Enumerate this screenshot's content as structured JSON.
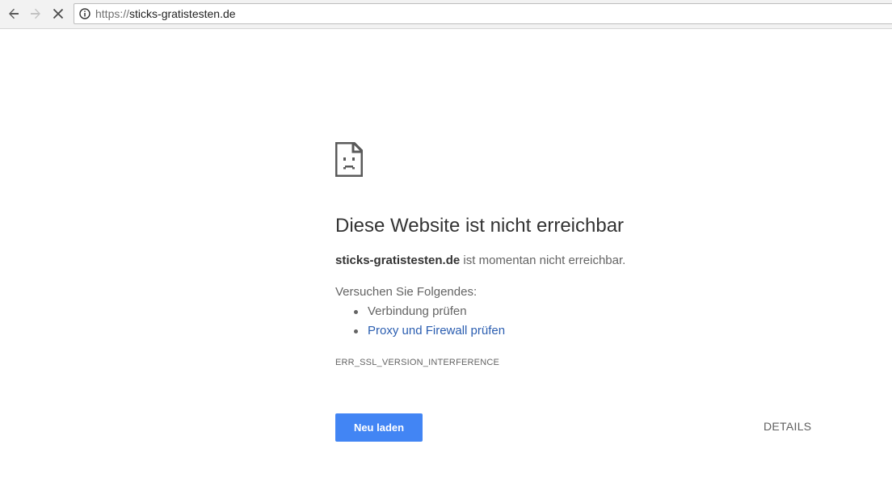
{
  "browser": {
    "back_icon": "arrow-left-icon",
    "forward_icon": "arrow-right-icon",
    "stop_icon": "close-icon",
    "info_icon": "info-icon",
    "url_scheme": "https://",
    "url_host": "sticks-gratistesten.de"
  },
  "error_page": {
    "icon": "sad-document-icon",
    "title": "Diese Website ist nicht erreichbar",
    "host": "sticks-gratistesten.de",
    "subtitle_suffix": " ist momentan nicht erreichbar.",
    "suggestions_heading": "Versuchen Sie Folgendes:",
    "suggestions": [
      {
        "label": "Verbindung prüfen",
        "is_link": false
      },
      {
        "label": "Proxy und Firewall prüfen",
        "is_link": true
      }
    ],
    "error_code": "ERR_SSL_VERSION_INTERFERENCE",
    "reload_label": "Neu laden",
    "details_label": "DETAILS"
  },
  "colors": {
    "primary_button": "#4285f4",
    "link": "#2a5db0",
    "text": "#333333",
    "secondary_text": "#646464"
  }
}
